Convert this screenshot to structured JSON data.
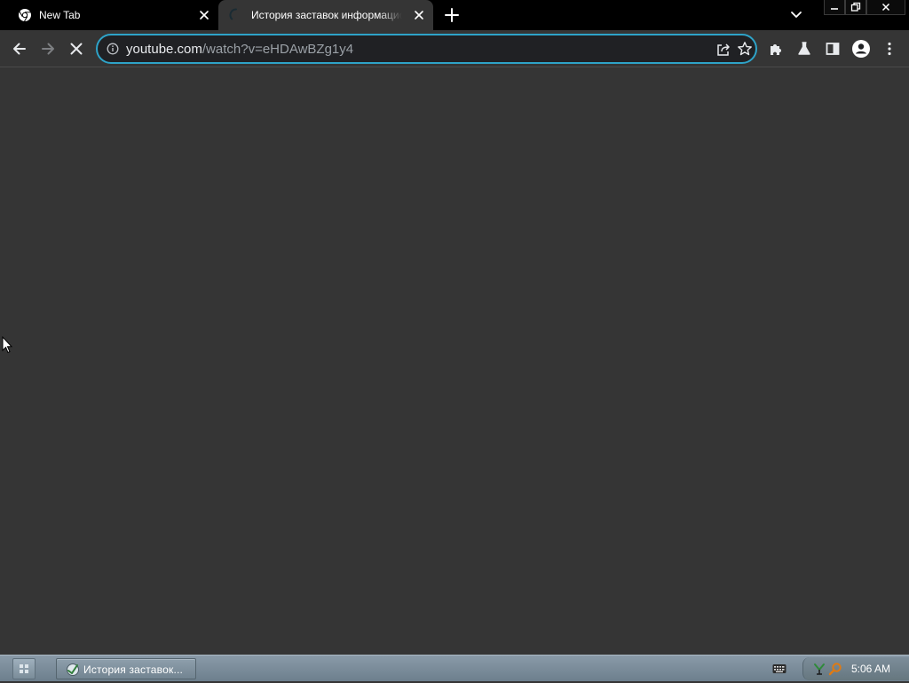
{
  "tabs": [
    {
      "title": "New Tab",
      "favicon": "chrome-icon",
      "active": false
    },
    {
      "title": "История заставок информационных",
      "favicon": "loading-spinner-icon",
      "active": true
    }
  ],
  "tab_strip": {
    "new_tab_icon": "plus-icon",
    "tab_search_icon": "chevron-down-icon"
  },
  "window_controls": {
    "minimize_icon": "minimize-icon",
    "maximize_icon": "restore-icon",
    "close_icon": "close-icon"
  },
  "toolbar": {
    "back_icon": "arrow-left-icon",
    "forward_icon": "arrow-right-icon",
    "stop_icon": "stop-x-icon",
    "extensions_icon": "puzzle-icon",
    "labs_icon": "flask-icon",
    "side_panel_icon": "side-panel-icon",
    "profile_icon": "profile-avatar-icon",
    "menu_icon": "kebab-menu-icon"
  },
  "omnibox": {
    "url_host": "youtube.com",
    "url_path": "/watch?v=eHDAwBZg1y4",
    "security_icon": "info-icon",
    "share_icon": "share-icon",
    "bookmark_icon": "star-icon"
  },
  "taskbar": {
    "start_icon": "start-grid-icon",
    "task_label": "История заставок...",
    "keyboard_icon": "keyboard-icon",
    "clock": "5:06 AM"
  },
  "colors": {
    "tabstrip_bg": "#000000",
    "content_bg": "#353535",
    "omnibox_bg": "#202124",
    "omnibox_focus": "#2ea3c8",
    "taskbar_bg": "#7b8c99"
  }
}
